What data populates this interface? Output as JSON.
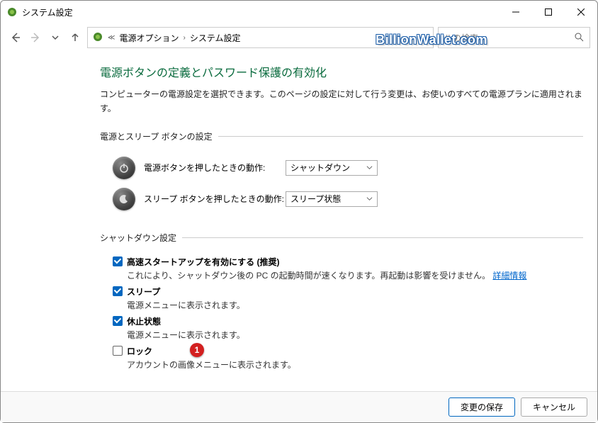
{
  "window": {
    "title": "システム設定"
  },
  "breadcrumb": {
    "item1": "電源オプション",
    "item2": "システム設定"
  },
  "search": {
    "placeholder": "ルの検索"
  },
  "watermark": "BillionWallet.com",
  "page": {
    "title": "電源ボタンの定義とパスワード保護の有効化",
    "desc": "コンピューターの電源設定を選択できます。このページの設定に対して行う変更は、お使いのすべての電源プランに適用されます。"
  },
  "groups": {
    "buttons": {
      "legend": "電源とスリープ ボタンの設定",
      "power": {
        "label": "電源ボタンを押したときの動作:",
        "value": "シャットダウン"
      },
      "sleep": {
        "label": "スリープ ボタンを押したときの動作:",
        "value": "スリープ状態"
      }
    },
    "shutdown": {
      "legend": "シャットダウン設定",
      "fast": {
        "title": "高速スタートアップを有効にする (推奨)",
        "desc": "これにより、シャットダウン後の PC の起動時間が速くなります。再起動は影響を受けません。",
        "link": "詳細情報"
      },
      "sleep": {
        "title": "スリープ",
        "desc": "電源メニューに表示されます。"
      },
      "hibernate": {
        "title": "休止状態",
        "desc": "電源メニューに表示されます。"
      },
      "lock": {
        "title": "ロック",
        "desc": "アカウントの画像メニューに表示されます。"
      }
    }
  },
  "marker": "1",
  "footer": {
    "save": "変更の保存",
    "cancel": "キャンセル"
  }
}
